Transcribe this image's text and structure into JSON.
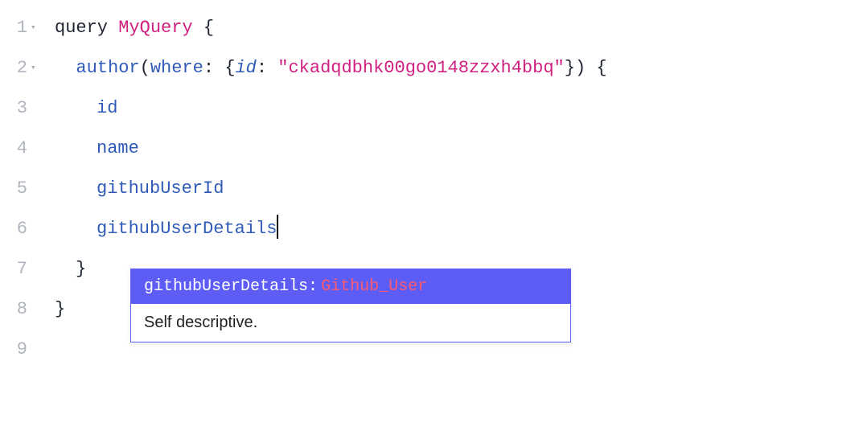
{
  "editor": {
    "lines": [
      {
        "number": "1",
        "fold": "▾"
      },
      {
        "number": "2",
        "fold": "▾"
      },
      {
        "number": "3",
        "fold": ""
      },
      {
        "number": "4",
        "fold": ""
      },
      {
        "number": "5",
        "fold": ""
      },
      {
        "number": "6",
        "fold": ""
      },
      {
        "number": "7",
        "fold": ""
      },
      {
        "number": "8",
        "fold": ""
      },
      {
        "number": "9",
        "fold": ""
      }
    ],
    "content": {
      "keyword_query": "query",
      "query_name": "MyQuery",
      "brace_open": "{",
      "brace_close": "}",
      "paren_open": "(",
      "paren_close": ")",
      "field_author": "author",
      "arg_where": "where",
      "arg_id": "id",
      "colon": ":",
      "id_value": "\"ckadqdbhk00go0148zzxh4bbq\"",
      "field_id": "id",
      "field_name": "name",
      "field_githubUserId": "githubUserId",
      "field_githubUserDetails": "githubUserDetails"
    }
  },
  "autocomplete": {
    "suggestion_field": "githubUserDetails",
    "suggestion_colon": ": ",
    "suggestion_type": "Github_User",
    "description": "Self descriptive."
  }
}
